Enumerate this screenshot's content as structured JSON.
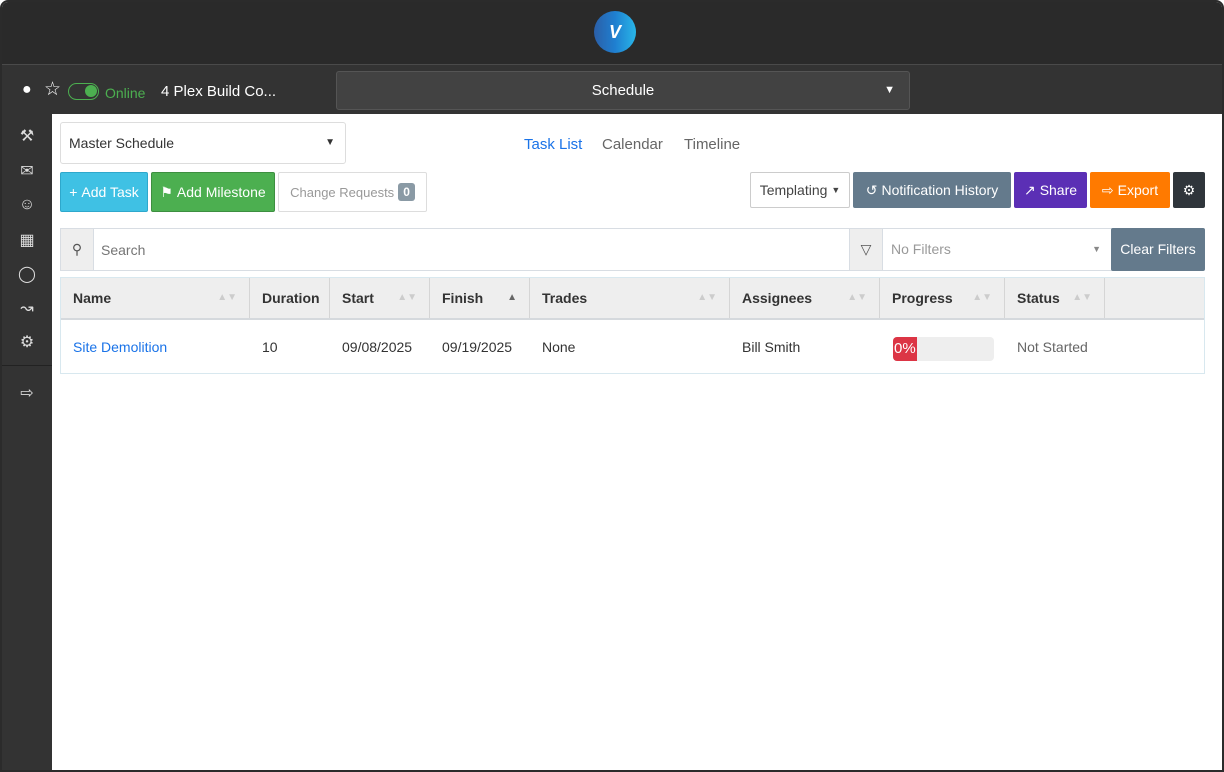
{
  "header": {
    "logo": "V"
  },
  "subbar": {
    "status": "Online",
    "project": "4 Plex Build Co...",
    "module": "Schedule"
  },
  "sidebar": [
    "hammer-icon",
    "mail-icon",
    "team-icon",
    "calendar-icon",
    "user-clock-icon",
    "chart-icon",
    "gear-icon",
    "logout-icon"
  ],
  "schedule_select": "Master Schedule",
  "views": [
    "Task List",
    "Calendar",
    "Timeline"
  ],
  "toolbar": {
    "add_task": "Add Task",
    "add_milestone": "Add Milestone",
    "change_requests": "Change Requests",
    "change_requests_count": "0",
    "templating": "Templating",
    "notification_history": "Notification History",
    "share": "Share",
    "export": "Export"
  },
  "colors": {
    "add_task": "#3fc1e4",
    "add_milestone": "#4caf50",
    "notification": "#647a8c",
    "share": "#5b2fb5",
    "export": "#ff7a00",
    "settings": "#2f353b",
    "link": "#1a73e8",
    "progress": "#dc3545"
  },
  "search": {
    "placeholder": "Search",
    "filters_placeholder": "No Filters",
    "clear": "Clear Filters"
  },
  "table": {
    "columns": [
      "Name",
      "Duration",
      "Start",
      "Finish",
      "Trades",
      "Assignees",
      "Progress",
      "Status"
    ],
    "rows": [
      {
        "name": "Site Demolition",
        "duration": "10",
        "start": "09/08/2025",
        "finish": "09/19/2025",
        "trades": "None",
        "assignees": "Bill Smith",
        "progress": 0,
        "progress_label": "0%",
        "status": "Not Started"
      }
    ]
  }
}
